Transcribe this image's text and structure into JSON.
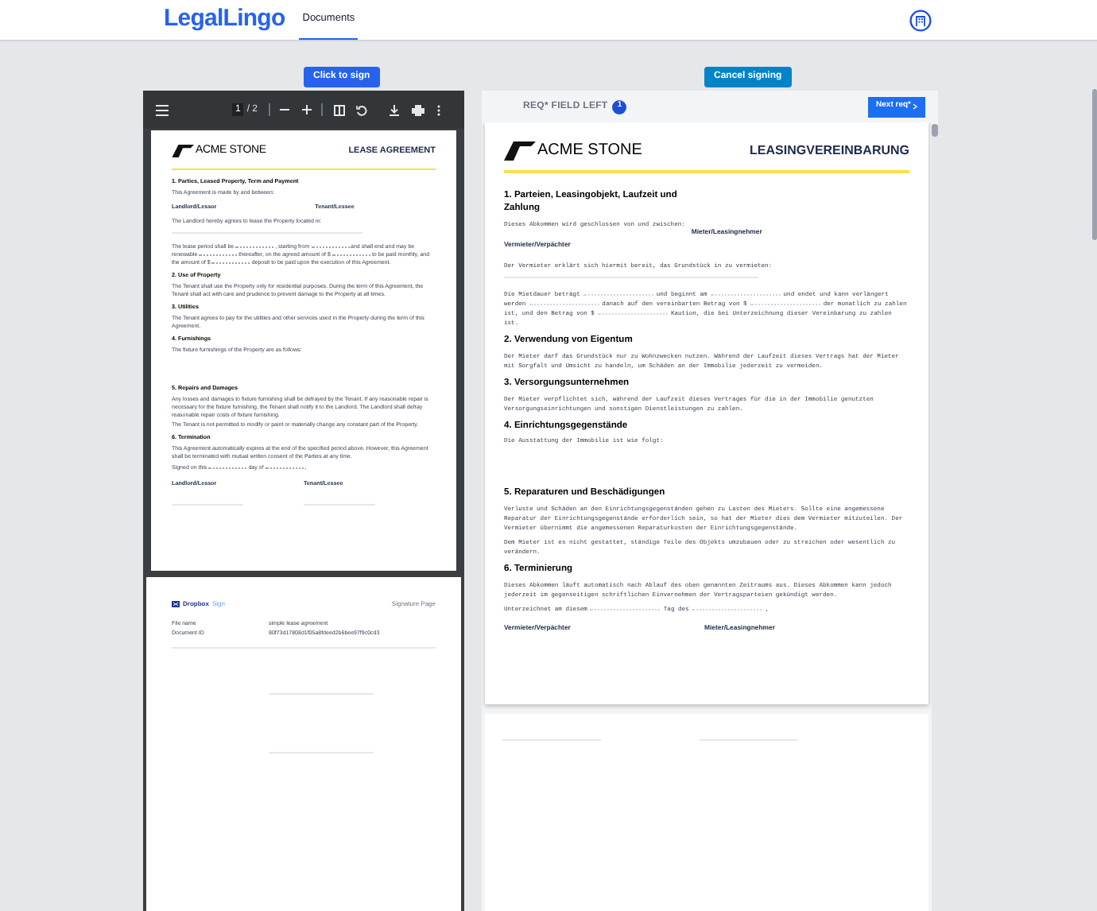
{
  "header": {
    "brand": "LegalLingo",
    "nav": [
      {
        "label": "Documents",
        "selected": true
      }
    ]
  },
  "actions": {
    "sign_button": "Click to sign",
    "cancel_button": "Cancel signing"
  },
  "pdf_viewer": {
    "toolbar": {
      "page": "1",
      "total": "/ 2"
    },
    "document": {
      "logo": "ACME STONE",
      "title": "LEASE AGREEMENT",
      "blocks": [
        {
          "kind": "heading",
          "text": "1. Parties, Leased Property, Term and Payment"
        },
        {
          "kind": "paragraph",
          "text": "This Agreement is made by and between:"
        },
        {
          "kind": "parties",
          "left": "Landlord/Lessor",
          "right": "Tenant/Lessee"
        },
        {
          "kind": "paragraph",
          "text": "The Landlord hereby agrees to lease the Property located in:"
        },
        {
          "kind": "blank_line"
        },
        {
          "kind": "fill",
          "parts": [
            "The lease period shall be",
            ", starting from",
            "and shall end and may be renewable",
            "thereafter, on the agreed amount of $",
            "to be paid monthly, and the amount of $",
            "deposit to be paid upon the execution of this Agreement."
          ]
        },
        {
          "kind": "heading",
          "text": "2. Use of Property"
        },
        {
          "kind": "paragraph",
          "text": "The Tenant shall use the Property only for residential purposes. During the term of this Agreement, the Tenant shall act with care and prudence to prevent damage to the Property at all times."
        },
        {
          "kind": "heading",
          "text": "3. Utilities"
        },
        {
          "kind": "paragraph",
          "text": "The Tenant agrees to pay for the utilities and other services used in the Property during the term of this Agreement."
        },
        {
          "kind": "heading",
          "text": "4. Furnishings"
        },
        {
          "kind": "paragraph",
          "text": "The fixture furnishings of the Property are as follows:",
          "blank_area": true
        },
        {
          "kind": "heading",
          "text": "5. Repairs and Damages"
        },
        {
          "kind": "paragraph",
          "text": "Any losses and damages to fixture furnishing shall be defrayed by the Tenant. If any reasonable repair is necessary for the fixture furnishing, the Tenant shall notify it to the Landlord. The Landlord shall defray reasonable repair costs of fixture furnishing."
        },
        {
          "kind": "paragraph",
          "text": "The Tenant is not permitted to modify or paint or materially change any constant part of the Property."
        },
        {
          "kind": "heading",
          "text": "6. Termination"
        },
        {
          "kind": "paragraph",
          "text": "This Agreement automatically expires at the end of the specified period above. However, this Agreement shall be terminated with mutual written consent of the Parties at any time."
        },
        {
          "kind": "fill",
          "parts": [
            "Signed on this",
            "day of",
            ","
          ]
        },
        {
          "kind": "signatures",
          "left": "Landlord/Lessor",
          "right": "Tenant/Lessee"
        }
      ]
    },
    "signature_page": {
      "brand": "Dropbox",
      "brand_suffix": "Sign",
      "title": "Signature Page",
      "rows": [
        {
          "label": "File name",
          "value": "simple lease agreement"
        },
        {
          "label": "Document ID",
          "value": "80f73d17808d1f05a8fdeed2b6bee97f9c0cd3"
        }
      ]
    }
  },
  "signing_panel": {
    "required": {
      "label": "REQ* FIELD LEFT",
      "count": "1"
    },
    "next_button": "Next req*",
    "document": {
      "logo": "ACME STONE",
      "title": "LEASINGVEREINBARUNG",
      "blocks": [
        {
          "kind": "heading",
          "text": "1. Parteien, Leasingobjekt, Laufzeit und Zahlung"
        },
        {
          "kind": "paragraph",
          "text": "Dieses Abkommen wird geschlossen von und zwischen:"
        },
        {
          "kind": "parties",
          "left": "Vermieter/Verpächter",
          "right": "Mieter/Leasingnehmer"
        },
        {
          "kind": "paragraph",
          "text": "Der Vermieter erklärt sich hiermit bereit, das Grundstück in zu vermieten:"
        },
        {
          "kind": "blank_line"
        },
        {
          "kind": "fill",
          "parts": [
            "Die Mietdauer beträgt",
            "und beginnt am",
            "und endet und kann verlängert werden",
            "danach auf den vereinbarten Betrag von $",
            "der monatlich zu zahlen ist, und den Betrag von $",
            "Kaution, die bei Unterzeichnung dieser Vereinbarung zu zahlen ist."
          ]
        },
        {
          "kind": "heading",
          "text": "2. Verwendung von Eigentum"
        },
        {
          "kind": "paragraph",
          "text": "Der Mieter darf das Grundstück nur zu Wohnzwecken nutzen. Während der Laufzeit dieses Vertrags hat der Mieter mit Sorgfalt und Umsicht zu handeln, um Schäden an der Immobilie jederzeit zu vermeiden."
        },
        {
          "kind": "heading",
          "text": "3. Versorgungsunternehmen"
        },
        {
          "kind": "paragraph",
          "text": "Der Mieter verpflichtet sich, während der Laufzeit dieses Vertrages für die in der Immobilie genutzten Versorgungseinrichtungen und sonstigen Dienstleistungen zu zahlen."
        },
        {
          "kind": "heading",
          "text": "4. Einrichtungsgegenstände"
        },
        {
          "kind": "paragraph",
          "text": "Die Ausstattung der Immobilie ist wie folgt:",
          "blank_area": true
        },
        {
          "kind": "heading",
          "text": "5. Reparaturen und Beschädigungen"
        },
        {
          "kind": "paragraph",
          "text": "Verluste und Schäden an den Einrichtungsgegenständen gehen zu Lasten des Mieters. Sollte eine angemessene Reparatur der Einrichtungsgegenstände erforderlich sein, so hat der Mieter dies dem Vermieter mitzuteilen. Der Vermieter übernimmt die angemessenen Reparaturkosten der Einrichtungsgegenstände."
        },
        {
          "kind": "paragraph",
          "text": "Dem Mieter ist es nicht gestattet, ständige Teile des Objekts umzubauen oder zu streichen oder wesentlich zu verändern."
        },
        {
          "kind": "heading",
          "text": "6. Terminierung"
        },
        {
          "kind": "paragraph",
          "text": "Dieses Abkommen läuft automatisch nach Ablauf des oben genannten Zeitraums aus. Dieses Abkommen kann jedoch jederzeit im gegenseitigen schriftlichen Einvernehmen der Vertragsparteien gekündigt werden."
        },
        {
          "kind": "fill",
          "parts": [
            "Unterzeichnet am diesem",
            "Tag des",
            ","
          ]
        },
        {
          "kind": "signatures",
          "left": "Vermieter/Verpächter",
          "right": "Mieter/Leasingnehmer"
        }
      ]
    }
  }
}
